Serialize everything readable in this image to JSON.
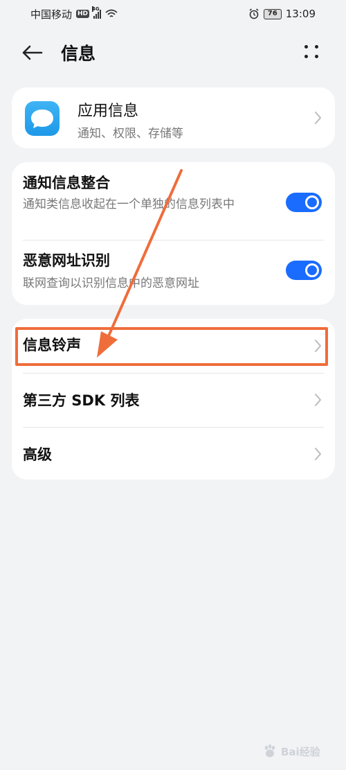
{
  "status_bar": {
    "carrier": "中国移动",
    "hd": "HD",
    "network": "4G",
    "battery": "76",
    "time": "13:09"
  },
  "header": {
    "title": "信息"
  },
  "app_info": {
    "title": "应用信息",
    "subtitle": "通知、权限、存储等"
  },
  "settings": [
    {
      "title": "通知信息整合",
      "description": "通知类信息收起在一个单独的信息列表中",
      "enabled": true
    },
    {
      "title": "恶意网址识别",
      "description": "联网查询以识别信息中的恶意网址",
      "enabled": true
    }
  ],
  "menu": {
    "ringtone": "信息铃声",
    "sdk_list": "第三方 SDK 列表",
    "advanced": "高级"
  },
  "watermark": {
    "brand_text": "Bai经验"
  },
  "colors": {
    "toggle_on": "#1a6cff",
    "highlight": "#ef6d3b",
    "app_icon": "#2aa6ee",
    "background": "#f1f3f5"
  }
}
